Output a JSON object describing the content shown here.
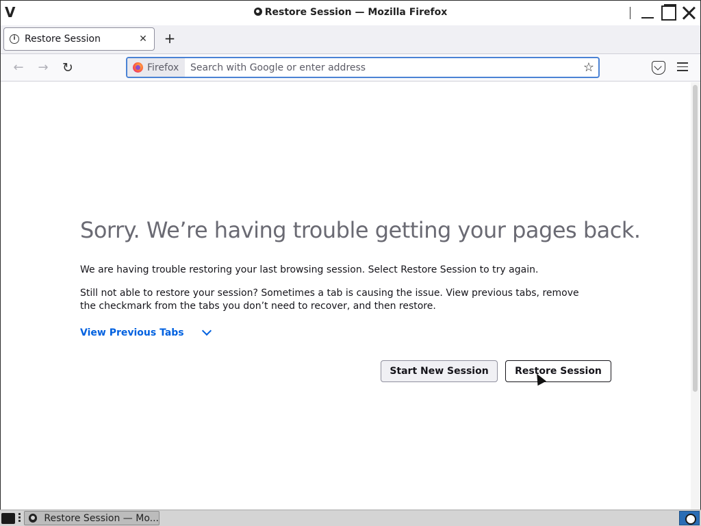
{
  "window": {
    "wm_logo": "V",
    "title": "Restore Session — Mozilla Firefox"
  },
  "tabs": [
    {
      "label": "Restore Session",
      "close": "✕",
      "icon": "info-icon"
    }
  ],
  "newtab_label": "+",
  "nav": {
    "back": "←",
    "forward": "→",
    "reload": "↻",
    "identity_label": "Firefox",
    "url_value": "",
    "url_placeholder": "Search with Google or enter address",
    "star": "☆"
  },
  "page": {
    "title": "Sorry. We’re having trouble getting your pages back.",
    "paragraph1": "We are having trouble restoring your last browsing session. Select Restore Session to try again.",
    "paragraph2": "Still not able to restore your session? Sometimes a tab is causing the issue. View previous tabs, remove the checkmark from the tabs you don’t need to recover, and then restore.",
    "view_previous_tabs": "View Previous Tabs",
    "start_new_session": "Start New Session",
    "restore_session": "Restore Session"
  },
  "taskbar": {
    "task_label": "Restore Session — Mo..."
  },
  "colors": {
    "link": "#0061e0",
    "urlbar_focus": "#4a82d4",
    "title_text": "#6a6a73"
  }
}
